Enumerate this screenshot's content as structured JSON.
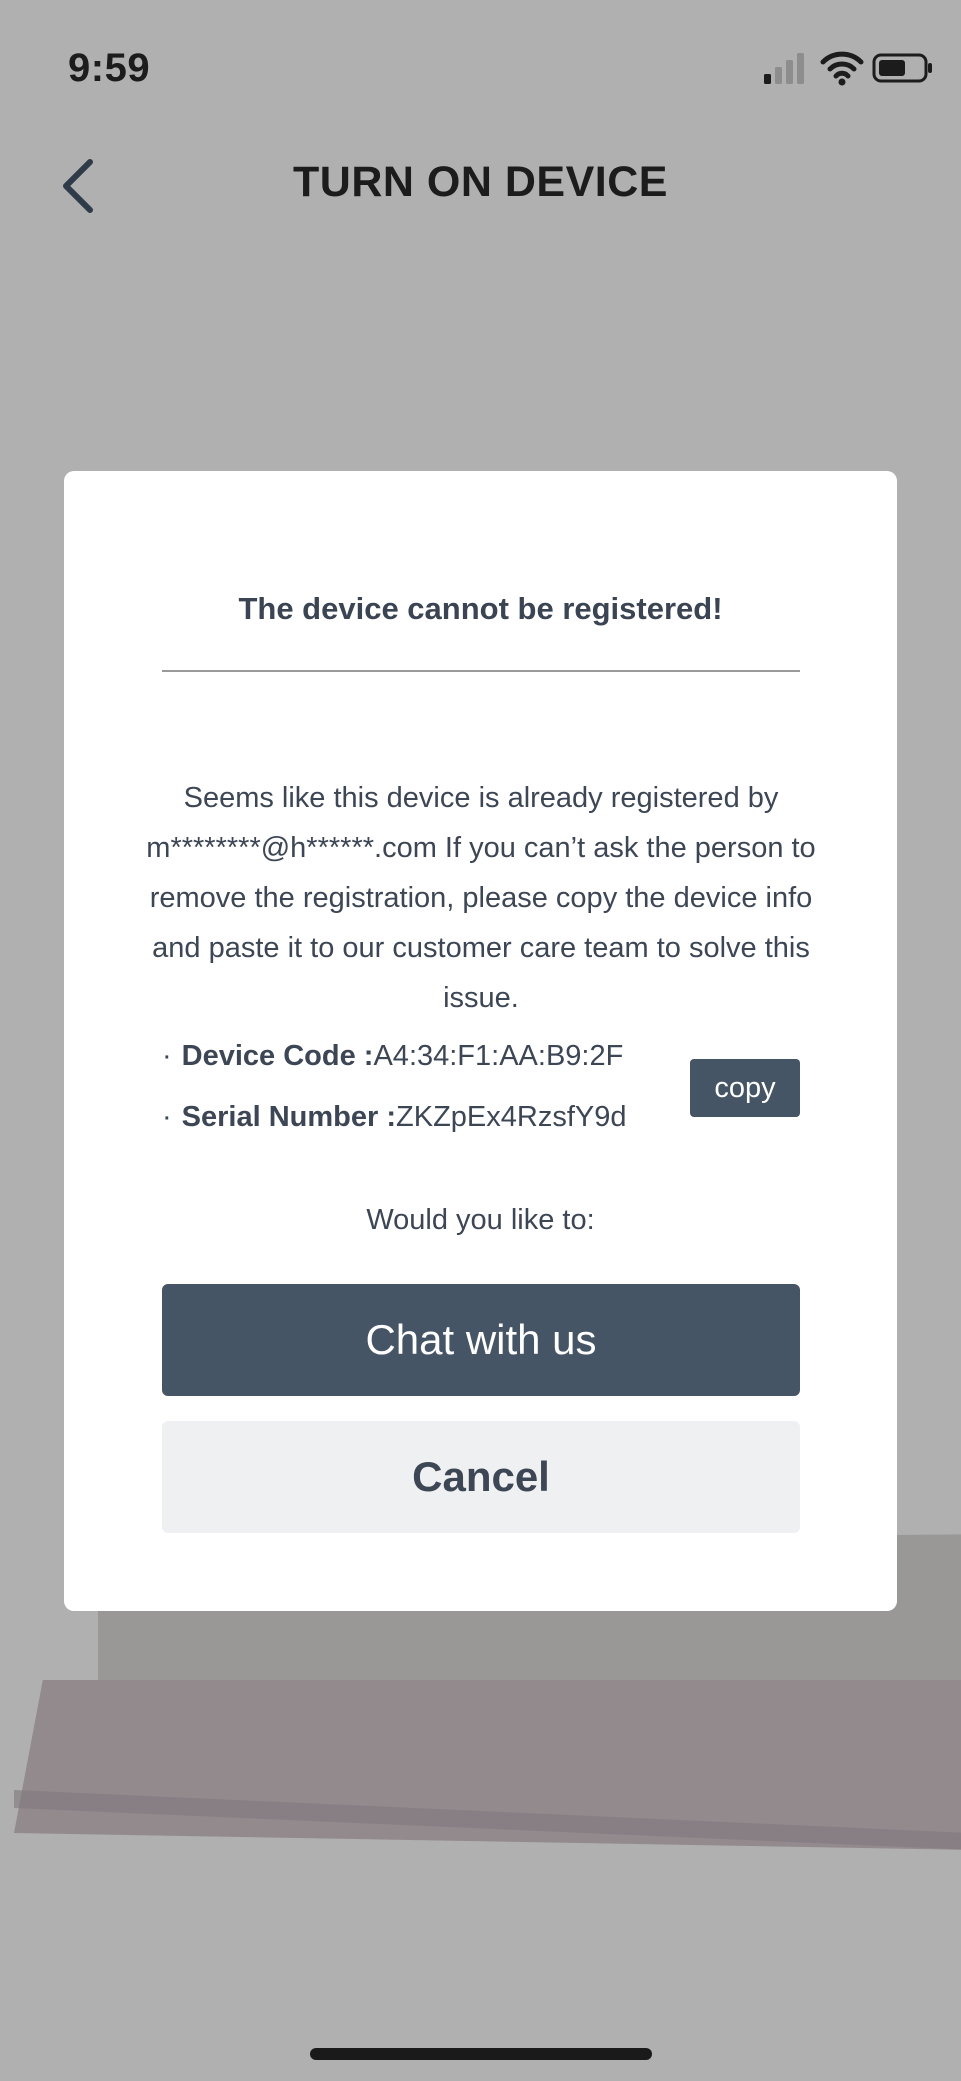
{
  "status_bar": {
    "time": "9:59",
    "icons": [
      "cellular-signal-icon",
      "wifi-icon",
      "battery-icon"
    ]
  },
  "nav": {
    "back_icon": "chevron-left-icon",
    "title": "TURN ON DEVICE"
  },
  "dialog": {
    "title": "The device cannot be registered!",
    "message": "Seems like this device is already registered by m********@h******.com If you can’t ask the person to remove the registration, please copy the device info and paste it to our customer care team to solve this issue.",
    "device_code_label": "Device Code :",
    "device_code_value": "A4:34:F1:AA:B9:2F",
    "serial_label": "Serial Number :",
    "serial_value": "ZKZpEx4RzsfY9d",
    "bullet": "·",
    "copy_label": "copy",
    "prompt": "Would you like to:",
    "chat_label": "Chat with us",
    "cancel_label": "Cancel"
  },
  "colors": {
    "overlay_bg": "#b0b0b0",
    "primary_button": "#465565",
    "secondary_button": "#eff0f2",
    "text": "#3d4654"
  }
}
